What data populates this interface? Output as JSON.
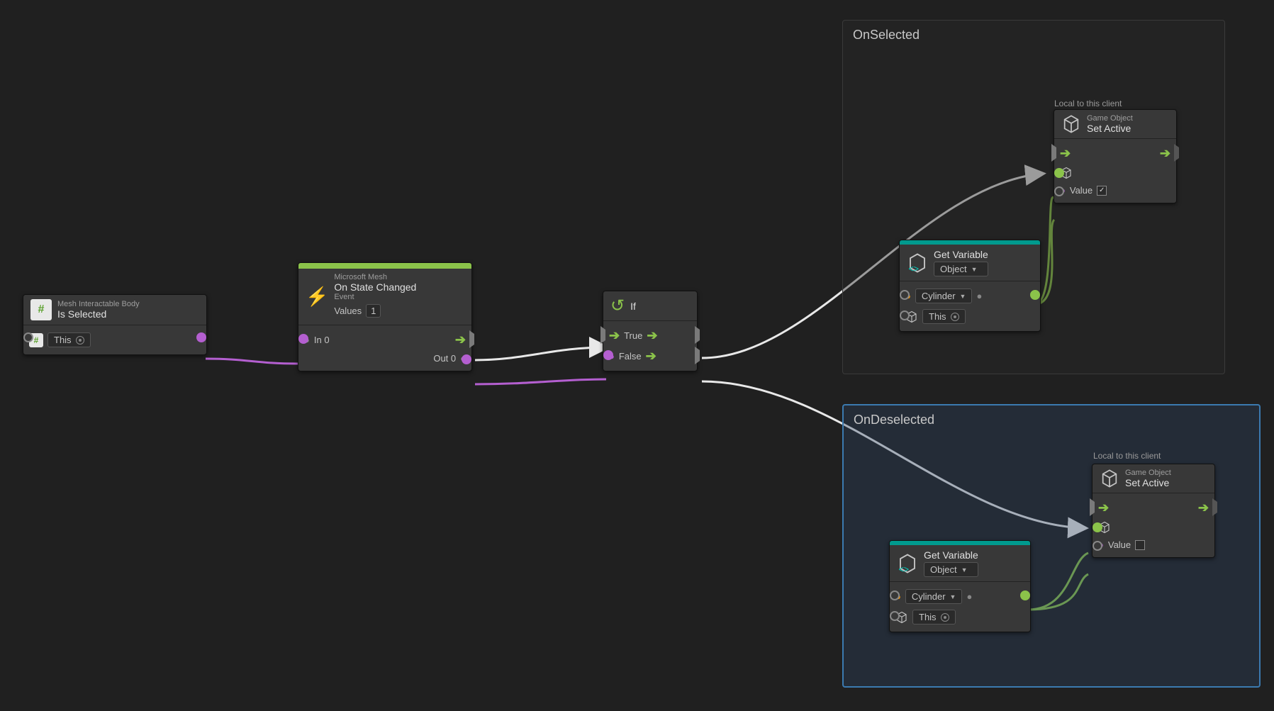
{
  "nodes": {
    "isSelected": {
      "subtitle": "Mesh Interactable Body",
      "title": "Is Selected",
      "thisLabel": "This"
    },
    "onStateChanged": {
      "subtitle": "Microsoft Mesh",
      "title": "On State Changed",
      "eventLabel": "Event",
      "valuesLabel": "Values",
      "valuesCount": "1",
      "in0": "In 0",
      "out0": "Out 0"
    },
    "ifNode": {
      "title": "If",
      "trueLabel": "True",
      "falseLabel": "False"
    },
    "getVariable": {
      "title": "Get Variable",
      "kind": "Object",
      "varName": "Cylinder",
      "thisLabel": "This"
    },
    "setActive": {
      "category": "Game Object",
      "title": "Set Active",
      "valueLabel": "Value"
    }
  },
  "groups": {
    "onSelected": {
      "title": "OnSelected",
      "scopeLabel": "Local to this client"
    },
    "onDeselected": {
      "title": "OnDeselected",
      "scopeLabel": "Local to this client"
    }
  }
}
